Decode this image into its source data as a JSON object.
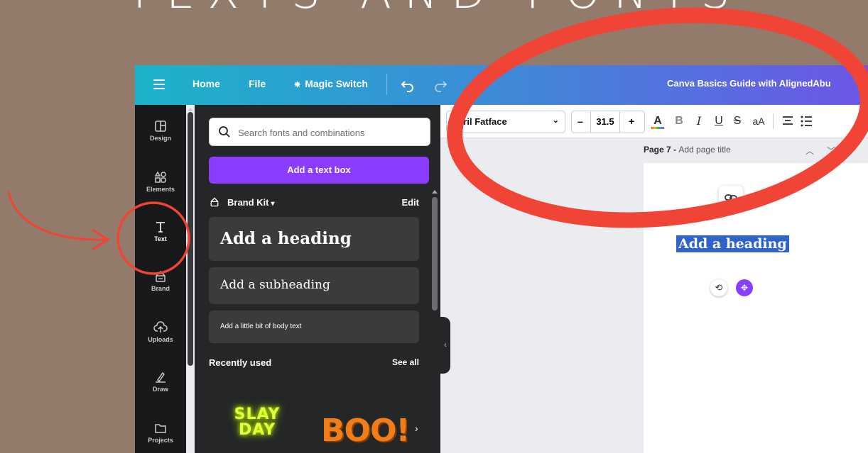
{
  "banner": {
    "text": "TEXTS AND FONTS"
  },
  "topbar": {
    "home": "Home",
    "file": "File",
    "magic_switch": "Magic Switch",
    "doc_title": "Canva Basics Guide with AlignedAbu"
  },
  "rail": {
    "items": [
      {
        "label": "Design",
        "icon": "design-icon"
      },
      {
        "label": "Elements",
        "icon": "elements-icon"
      },
      {
        "label": "Text",
        "icon": "text-icon"
      },
      {
        "label": "Brand",
        "icon": "brand-icon"
      },
      {
        "label": "Uploads",
        "icon": "uploads-icon"
      },
      {
        "label": "Draw",
        "icon": "draw-icon"
      },
      {
        "label": "Projects",
        "icon": "projects-icon"
      }
    ]
  },
  "panel": {
    "search_placeholder": "Search fonts and combinations",
    "add_text_box": "Add a text box",
    "brand_kit": "Brand Kit",
    "edit": "Edit",
    "heading": "Add a heading",
    "subheading": "Add a subheading",
    "body": "Add a little bit of body text",
    "recently_used": "Recently used",
    "see_all": "See all",
    "thumbs": [
      {
        "line1": "SLAY",
        "line2": "DAY"
      },
      {
        "line1": "BOO!"
      }
    ]
  },
  "toolbar": {
    "font": "Abril Fatface",
    "size": "31.5",
    "minus": "–",
    "plus": "+",
    "letter_a": "A",
    "bold": "B",
    "italic": "I",
    "underline": "U",
    "strike": "S",
    "case": "aA"
  },
  "canvas": {
    "page_label": "Page 7",
    "page_title_placeholder": "Add page title",
    "selected_text": "Add a heading"
  },
  "colors": {
    "accent": "#8b3dff",
    "annotation": "#f04437",
    "background": "#927b6b"
  }
}
